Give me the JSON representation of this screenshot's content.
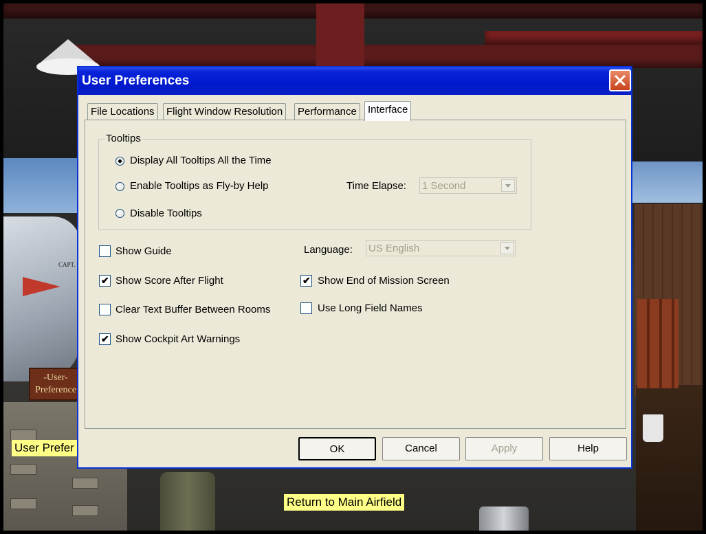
{
  "scene": {
    "hover_label": "User Prefer",
    "sign_text": "-User-\nPreference",
    "plane_marking": "CAPT.",
    "return_label": "Return to Main Airfield"
  },
  "dialog": {
    "title": "User Preferences",
    "tabs": [
      {
        "label": "File Locations",
        "active": false
      },
      {
        "label": "Flight Window Resolution",
        "active": false
      },
      {
        "label": "Performance",
        "active": false
      },
      {
        "label": "Interface",
        "active": true
      }
    ],
    "tooltips_group": {
      "legend": "Tooltips",
      "options": [
        {
          "label": "Display All Tooltips All the Time",
          "selected": true
        },
        {
          "label": "Enable Tooltips as Fly-by Help",
          "selected": false
        },
        {
          "label": "Disable Tooltips",
          "selected": false
        }
      ],
      "time_elapse_label": "Time Elapse:",
      "time_elapse_value": "1 Second"
    },
    "language_label": "Language:",
    "language_value": "US English",
    "checkboxes": [
      {
        "label": "Show Guide",
        "checked": false
      },
      {
        "label": "Show Score After Flight",
        "checked": true
      },
      {
        "label": "Clear Text Buffer Between Rooms",
        "checked": false
      },
      {
        "label": "Show Cockpit Art Warnings",
        "checked": true
      },
      {
        "label": "Show End of Mission Screen",
        "checked": true
      },
      {
        "label": "Use Long Field Names",
        "checked": false
      }
    ],
    "buttons": {
      "ok": "OK",
      "cancel": "Cancel",
      "apply": "Apply",
      "help": "Help"
    },
    "check_glyph": "✔"
  },
  "colors": {
    "titlebar": "#0019cf",
    "dialog_bg": "#ece9d8",
    "label_bg": "#ffff88"
  }
}
